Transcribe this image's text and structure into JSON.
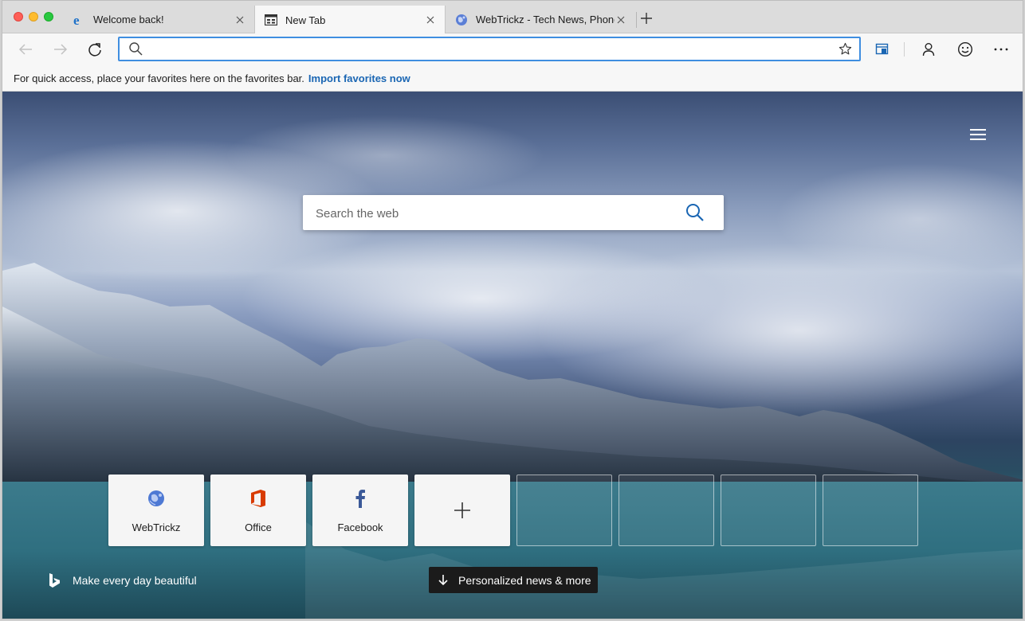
{
  "tabs": [
    {
      "title": "Welcome back!",
      "icon": "edge-logo-icon",
      "active": false
    },
    {
      "title": "New Tab",
      "icon": "new-tab-page-icon",
      "active": true
    },
    {
      "title": "WebTrickz - Tech News, Phone",
      "icon": "webtrickz-globe-icon",
      "active": false
    }
  ],
  "toolbar": {
    "address_value": "",
    "address_placeholder": ""
  },
  "favorites_bar": {
    "message": "For quick access, place your favorites here on the favorites bar.",
    "import_link": "Import favorites now"
  },
  "new_tab_page": {
    "search_placeholder": "Search the web",
    "top_sites": [
      {
        "label": "WebTrickz",
        "icon": "globe-icon"
      },
      {
        "label": "Office",
        "icon": "office-logo-icon"
      },
      {
        "label": "Facebook",
        "icon": "facebook-logo-icon"
      }
    ],
    "add_site_icon": "plus-icon",
    "empty_slots": 4,
    "tagline": "Make every day beautiful",
    "news_button": "Personalized news & more"
  },
  "colors": {
    "accent": "#3f8ee0",
    "link": "#1a66b3",
    "office_red": "#d83b01",
    "facebook_blue": "#3b5998"
  }
}
